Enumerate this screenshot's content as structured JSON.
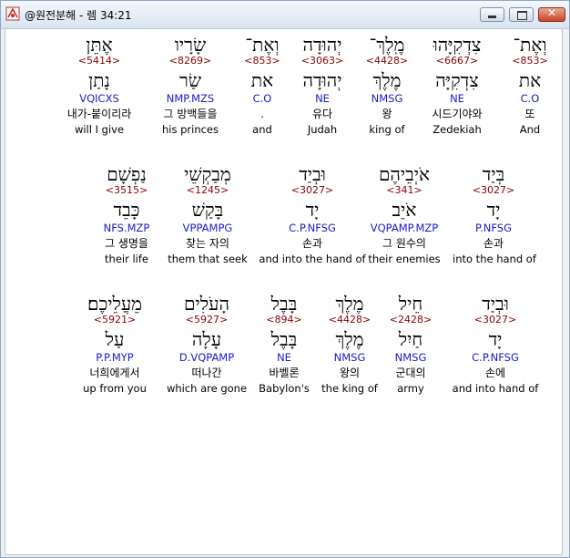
{
  "window": {
    "title": "@원전분해 - 렘 34:21"
  },
  "rows": [
    {
      "words": [
        {
          "heb": "וְאֶת־",
          "num": "<853>",
          "lex": "את",
          "parse": "C.O",
          "kor": "또",
          "eng": "And"
        },
        {
          "heb": "צִדְקִיָּהוּ",
          "num": "<6667>",
          "lex": "צִדְקִיָּה",
          "parse": "NE",
          "kor": "시드기야와",
          "eng": "Zedekiah"
        },
        {
          "heb": "מֶֽלֶךְ־",
          "num": "<4428>",
          "lex": "מֶלֶךְ",
          "parse": "NMSG",
          "kor": "왕",
          "eng": "king of"
        },
        {
          "heb": "יְהוּדָה",
          "num": "<3063>",
          "lex": "יְהוּדָה",
          "parse": "NE",
          "kor": "유다",
          "eng": "Judah"
        },
        {
          "heb": "וְאֶת־",
          "num": "<853>",
          "lex": "את",
          "parse": "C.O",
          "kor": ".",
          "eng": "and"
        },
        {
          "heb": "שָׂרָיו",
          "num": "<8269>",
          "lex": "שַׂר",
          "parse": "NMP.MZS",
          "kor": "그 방백들을",
          "eng": "his princes"
        },
        {
          "heb": "אֶתֵּן",
          "num": "<5414>",
          "lex": "נָתַן",
          "parse": "VQICXS",
          "kor": "내가-붙이리라",
          "eng": "will I give"
        }
      ]
    },
    {
      "words": [
        {
          "heb": "בְּיַד",
          "num": "<3027>",
          "lex": "יָד",
          "parse": "P.NFSG",
          "kor": "손과",
          "eng": "into the hand of"
        },
        {
          "heb": "אֹיְבֵיהֶם",
          "num": "<341>",
          "lex": "אֹיֵב",
          "parse": "VQPAMP.MZP",
          "kor": "그 원수의",
          "eng": "their enemies"
        },
        {
          "heb": "וּבְיַד",
          "num": "<3027>",
          "lex": "יָד",
          "parse": "C.P.NFSG",
          "kor": "손과",
          "eng": "and into the hand of"
        },
        {
          "heb": "מְבַקְשֵׁי",
          "num": "<1245>",
          "lex": "בָּקַשׁ",
          "parse": "VPPAMPG",
          "kor": "찾는 자의",
          "eng": "them that seek"
        },
        {
          "heb": "נַפְשָׁם",
          "num": "<3515>",
          "lex": "כָּבֵד",
          "parse": "NFS.MZP",
          "kor": "그 생명을",
          "eng": "their life"
        }
      ]
    },
    {
      "words": [
        {
          "heb": "וּבְיַד",
          "num": "<3027>",
          "lex": "יָד",
          "parse": "C.P.NFSG",
          "kor": "손에",
          "eng": "and into hand of"
        },
        {
          "heb": "חֵיל",
          "num": "<2428>",
          "lex": "חַיִל",
          "parse": "NMSG",
          "kor": "군대의",
          "eng": "army"
        },
        {
          "heb": "מֶלֶךְ",
          "num": "<4428>",
          "lex": "מֶלֶךְ",
          "parse": "NMSG",
          "kor": "왕의",
          "eng": "the king of"
        },
        {
          "heb": "בָּבֶל",
          "num": "<894>",
          "lex": "בָּבֶל",
          "parse": "NE",
          "kor": "바벨론",
          "eng": "Babylon's"
        },
        {
          "heb": "הָעֹלִים",
          "num": "<5927>",
          "lex": "עָלָה",
          "parse": "D.VQPAMP",
          "kor": "떠나간",
          "eng": "which are gone"
        },
        {
          "heb": "מֵעֲלֵיכֶם׃",
          "num": "<5921>",
          "lex": "עַל",
          "parse": "P.P.MYP",
          "kor": "너희에게서",
          "eng": "up from you"
        }
      ]
    }
  ]
}
